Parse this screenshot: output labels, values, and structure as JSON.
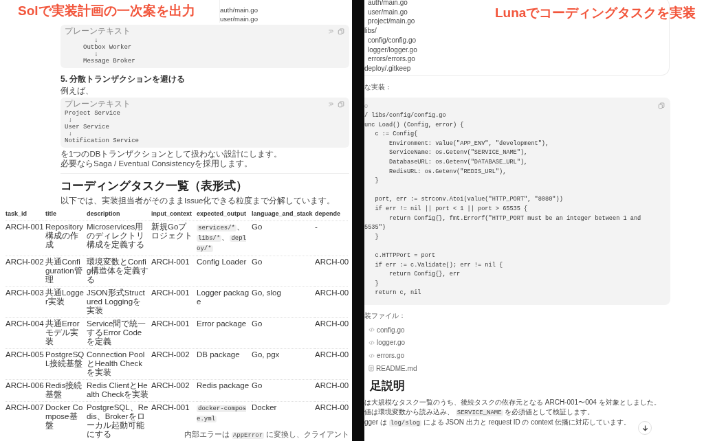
{
  "left_panel": {
    "caption": "Solで実装計画の一次案を出力",
    "file_tree_fragment": [
      "auth/main.go",
      "user/main.go"
    ],
    "blocks": [
      {
        "kind": "code",
        "label": "プレーンテキスト",
        "lines": [
          "        ↓",
          "     Outbox Worker",
          "        ↓",
          "     Message Broker"
        ]
      },
      {
        "kind": "heading",
        "text": "5. 分散トランザクションを避ける"
      },
      {
        "kind": "paragraph",
        "text": "例えば、"
      },
      {
        "kind": "code",
        "label": "プレーンテキスト",
        "lines": [
          "Project Service",
          " ↓",
          "User Service",
          " ↓",
          "Notification Service"
        ]
      },
      {
        "kind": "paragraph",
        "text": "を1つのDBトランザクションとして扱わない設計にします。"
      },
      {
        "kind": "paragraph",
        "text": "必要ならSaga / Eventual Consistencyを採用します。"
      },
      {
        "kind": "rule"
      },
      {
        "kind": "title",
        "text": "コーディングタスク一覧（表形式）"
      },
      {
        "kind": "paragraph",
        "text": "以下では、実装担当者がそのままIssue化できる粒度まで分解しています。"
      }
    ],
    "table": {
      "columns": [
        "task_id",
        "title",
        "description",
        "input_context",
        "expected_output",
        "language_and_stack",
        "depende"
      ],
      "rows": [
        {
          "cells": [
            "ARCH-001",
            "Repository構成の作成",
            "Microservices用のディレクトリ構成を定義する",
            "新規Goプロジェクト",
            [
              {
                "text": "services/*",
                "code": true
              },
              {
                "text": "、",
                "code": false
              },
              {
                "text": "libs/*",
                "code": true
              },
              {
                "text": "、",
                "code": false
              },
              {
                "text": "deploy/*",
                "code": true
              }
            ],
            "Go",
            "-"
          ]
        },
        {
          "cells": [
            "ARCH-002",
            "共通Configuration管理",
            "環境変数とConfig構造体を定義する",
            "ARCH-001",
            "Config Loader",
            "Go",
            "ARCH-00"
          ]
        },
        {
          "cells": [
            "ARCH-003",
            "共通Logger実装",
            "JSON形式Structured Loggingを実装",
            "ARCH-001",
            "Logger package",
            "Go, slog",
            "ARCH-00"
          ]
        },
        {
          "cells": [
            "ARCH-004",
            "共通Errorモデル実装",
            "Service間で統一するError Codeを定義",
            "ARCH-001",
            "Error package",
            "Go",
            "ARCH-00"
          ]
        },
        {
          "cells": [
            "ARCH-005",
            "PostgreSQL接続基盤",
            "Connection PoolとHealth Checkを実装",
            "ARCH-002",
            "DB package",
            "Go, pgx",
            "ARCH-00"
          ]
        },
        {
          "cells": [
            "ARCH-006",
            "Redis接続基盤",
            "Redis ClientとHealth Checkを実装",
            "ARCH-002",
            "Redis package",
            "Go",
            "ARCH-00"
          ]
        },
        {
          "cells": [
            "ARCH-007",
            "Docker Compose基盤",
            "PostgreSQL、Redis、Brokerをローカル起動可能にする",
            "ARCH-001",
            [
              {
                "text": "docker-compose.yml",
                "code": true
              }
            ],
            "Docker",
            "ARCH-00"
          ]
        }
      ]
    },
    "overlay_line": [
      {
        "text": "内部エラーは ",
        "code": false
      },
      {
        "text": "AppError",
        "code": true
      },
      {
        "text": " に変換し、クライアント",
        "code": false
      }
    ]
  },
  "right_panel": {
    "caption": "Lunaでコーディングタスクを実装",
    "file_tree": [
      {
        "text": "auth/main.go",
        "nested": true
      },
      {
        "text": "user/main.go",
        "nested": true
      },
      {
        "text": "project/main.go",
        "nested": true
      },
      {
        "text": "libs/",
        "nested": false
      },
      {
        "text": "config/config.go",
        "nested": true
      },
      {
        "text": "logger/logger.go",
        "nested": true
      },
      {
        "text": "errors/errors.go",
        "nested": true
      },
      {
        "text": "deploy/.gitkeep",
        "nested": false
      }
    ],
    "intro": "な実装：",
    "code": {
      "label": "o",
      "groups": [
        [
          "/ libs/config/config.go",
          "unc Load() (Config, error) {",
          "   c := Config{",
          "       Environment: value(\"APP_ENV\", \"development\"),",
          "       ServiceName: os.Getenv(\"SERVICE_NAME\"),",
          "       DatabaseURL: os.Getenv(\"DATABASE_URL\"),",
          "       RedisURL: os.Getenv(\"REDIS_URL\"),",
          "   }"
        ],
        [
          "   port, err := strconv.Atoi(value(\"HTTP_PORT\", \"8080\"))",
          "   if err != nil || port < 1 || port > 65535 {",
          "       return Config{}, fmt.Errorf(\"HTTP_PORT must be an integer between 1 and",
          "5535\")",
          "   }"
        ],
        [
          "   c.HTTPPort = port",
          "   if err := c.Validate(); err != nil {",
          "       return Config{}, err",
          "   }",
          "   return c, nil"
        ]
      ]
    },
    "files_label": "装ファイル：",
    "files": [
      {
        "name": "config.go",
        "kind": "code"
      },
      {
        "name": "logger.go",
        "kind": "code"
      },
      {
        "name": "errors.go",
        "kind": "code"
      },
      {
        "name": "README.md",
        "kind": "doc"
      }
    ],
    "heading": "足説明",
    "notes": [
      [
        {
          "text": "は大規模なタスク一覧のうち、後続タスクの依存元となる ARCH-001〜004 を対象としました。",
          "code": false
        }
      ],
      [
        {
          "text": "値は環境変数から読み込み、 ",
          "code": false
        },
        {
          "text": "SERVICE_NAME",
          "code": true
        },
        {
          "text": " を必須値として検証します。",
          "code": false
        }
      ],
      [
        {
          "text": "gger は ",
          "code": false
        },
        {
          "text": "log/slog",
          "code": true
        },
        {
          "text": " による JSON 出力と request ID の context 伝播に対応しています。",
          "code": false
        }
      ]
    ]
  }
}
